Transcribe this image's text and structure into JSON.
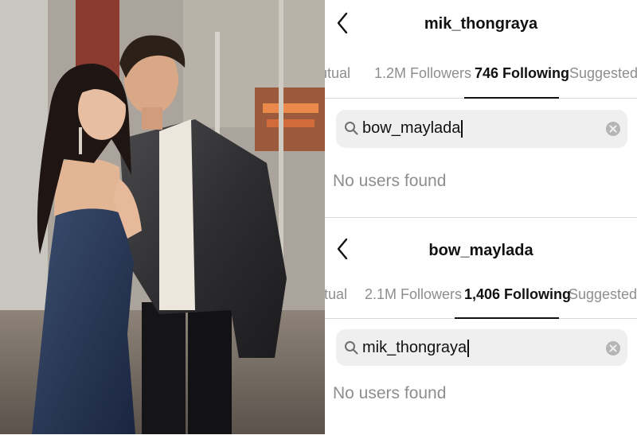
{
  "photo": {
    "caption": ""
  },
  "panels": [
    {
      "username": "mik_thongraya",
      "tabs": [
        {
          "label": "Mutual",
          "active": false
        },
        {
          "label": "1.2M Followers",
          "active": false
        },
        {
          "label": "746 Following",
          "active": true
        },
        {
          "label": "Suggested",
          "active": false
        }
      ],
      "search": {
        "value": "bow_maylada"
      },
      "empty_message": "No users found"
    },
    {
      "username": "bow_maylada",
      "tabs": [
        {
          "label": "Mutual",
          "active": false
        },
        {
          "label": "2.1M Followers",
          "active": false
        },
        {
          "label": "1,406 Following",
          "active": true
        },
        {
          "label": "Suggested",
          "active": false
        }
      ],
      "search": {
        "value": "mik_thongraya"
      },
      "empty_message": "No users found"
    }
  ],
  "icons": {
    "back": "chevron-left-icon",
    "search": "search-icon",
    "clear": "clear-x-icon"
  },
  "colors": {
    "text_primary": "#111111",
    "text_secondary": "#8e8e8e",
    "search_bg": "#efefef",
    "divider": "#d9d9d9"
  }
}
